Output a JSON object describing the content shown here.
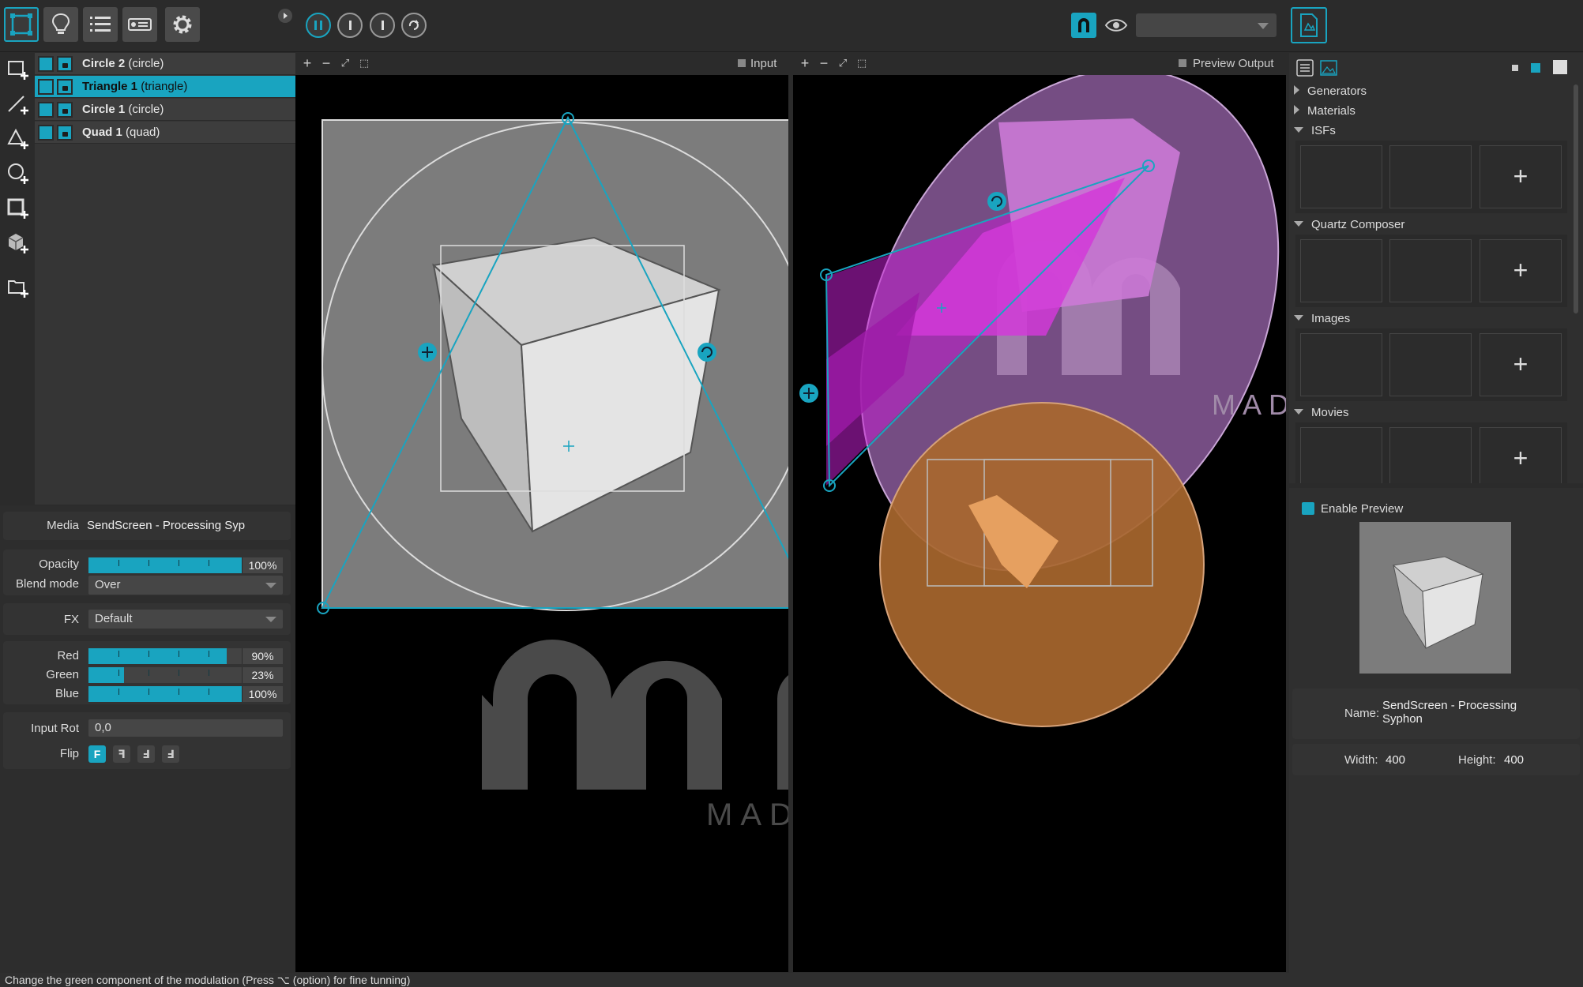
{
  "surfaces": [
    {
      "name": "Circle 2",
      "type": "(circle)",
      "selected": false
    },
    {
      "name": "Triangle 1",
      "type": "(triangle)",
      "selected": true
    },
    {
      "name": "Circle 1",
      "type": "(circle)",
      "selected": false
    },
    {
      "name": "Quad 1",
      "type": "(quad)",
      "selected": false
    }
  ],
  "properties": {
    "media_label": "Media",
    "media_value": "SendScreen - Processing Syp",
    "opacity_label": "Opacity",
    "opacity_value": "100%",
    "opacity_level": 1.0,
    "blend_label": "Blend mode",
    "blend_value": "Over",
    "fx_label": "FX",
    "fx_value": "Default",
    "red_label": "Red",
    "red_value": "90%",
    "red_level": 0.9,
    "green_label": "Green",
    "green_value": "23%",
    "green_level": 0.23,
    "blue_label": "Blue",
    "blue_value": "100%",
    "blue_level": 1.0,
    "input_rot_label": "Input Rot",
    "input_rot_value": "0,0",
    "flip_label": "Flip",
    "flip_buttons": [
      "F",
      "ꟻ",
      "Ⅎ",
      "Ⅎ"
    ]
  },
  "canvases": {
    "input_title": "Input",
    "output_title": "Preview Output",
    "watermark_text": "MAD",
    "watermark_text_right": "MAD"
  },
  "library": {
    "categories": [
      {
        "label": "Generators",
        "expanded": false
      },
      {
        "label": "Materials",
        "expanded": false
      },
      {
        "label": "ISFs",
        "expanded": true
      },
      {
        "label": "Quartz Composer",
        "expanded": true
      },
      {
        "label": "Images",
        "expanded": true
      },
      {
        "label": "Movies",
        "expanded": true
      }
    ],
    "add_symbol": "+"
  },
  "preview": {
    "enable_label": "Enable Preview",
    "name_label": "Name:",
    "name_value_1": "SendScreen - Processing",
    "name_value_2": "Syphon",
    "width_label": "Width:",
    "width_value": "400",
    "height_label": "Height:",
    "height_value": "400"
  },
  "status_text": "Change the green component of the modulation (Press ⌥ (option) for fine tunning)",
  "colors": {
    "accent": "#19a4c0",
    "magenta": "#c21fd0",
    "orange": "#b0692c",
    "purple": "#8a5a9a"
  },
  "icons": {
    "toolbar": [
      "surfaces-icon",
      "bulb-icon",
      "list-icon",
      "projector-icon",
      "gear-icon"
    ],
    "tools": [
      "add-quad-icon",
      "add-line-icon",
      "add-triangle-icon",
      "add-circle-icon",
      "add-mesh-icon",
      "add-3d-icon",
      "add-folder-icon"
    ]
  }
}
